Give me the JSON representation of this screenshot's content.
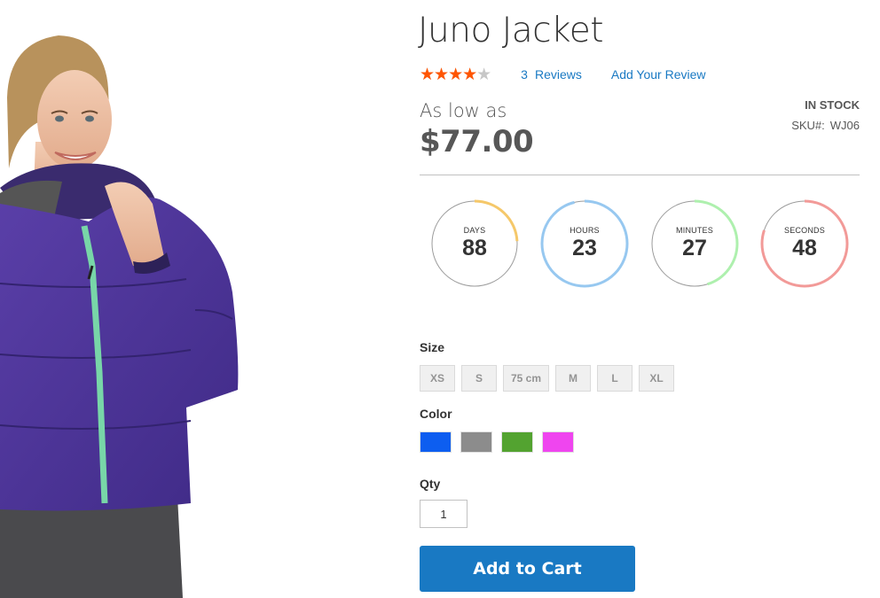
{
  "product": {
    "name": "Juno Jacket",
    "rating_percent": 80,
    "stars_glyph": "★★★★★",
    "reviews_count": "3",
    "reviews_label": "Reviews",
    "add_review_label": "Add Your Review",
    "price_label": "As low as",
    "price": "$77.00",
    "stock_status": "In stock",
    "sku_label": "SKU#:",
    "sku": "WJ06",
    "image_icon": "product-photo-woman-purple-jacket"
  },
  "countdown": [
    {
      "label": "DAYS",
      "value": "88",
      "color": "#f5c86a",
      "progress": 0.24
    },
    {
      "label": "HOURS",
      "value": "23",
      "color": "#97c8f0",
      "progress": 0.96
    },
    {
      "label": "MINUTES",
      "value": "27",
      "color": "#aef0ae",
      "progress": 0.45
    },
    {
      "label": "SECONDS",
      "value": "48",
      "color": "#f29a98",
      "progress": 0.8
    }
  ],
  "options": {
    "size_title": "Size",
    "sizes": [
      "XS",
      "S",
      "75 cm",
      "M",
      "L",
      "XL"
    ],
    "color_title": "Color",
    "colors": [
      "#0d5ef0",
      "#8c8c8c",
      "#53a330",
      "#ef45ef"
    ],
    "qty_title": "Qty",
    "qty_value": "1"
  },
  "actions": {
    "add_to_cart": "Add to Cart"
  },
  "theme": {
    "accent": "#1979c3",
    "star_color": "#ff5501",
    "price_color": "#575757"
  }
}
